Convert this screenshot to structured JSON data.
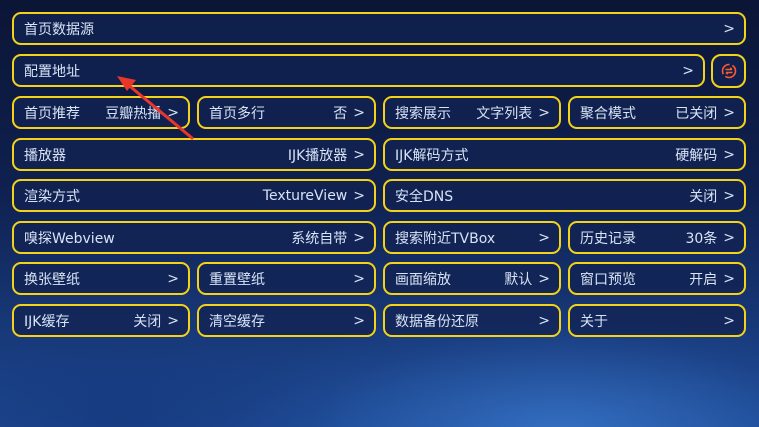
{
  "items": [
    {
      "label": "首页数据源",
      "value": "",
      "chevron": ">"
    },
    {
      "label": "配置地址",
      "value": "",
      "chevron": ">"
    },
    {
      "label": "首页推荐",
      "value": "豆瓣热播",
      "chevron": ">"
    },
    {
      "label": "首页多行",
      "value": "否",
      "chevron": ">"
    },
    {
      "label": "搜索展示",
      "value": "文字列表",
      "chevron": ">"
    },
    {
      "label": "聚合模式",
      "value": "已关闭",
      "chevron": ">"
    },
    {
      "label": "播放器",
      "value": "IJK播放器",
      "chevron": ">"
    },
    {
      "label": "IJK解码方式",
      "value": "硬解码",
      "chevron": ">"
    },
    {
      "label": "渲染方式",
      "value": "TextureView",
      "chevron": ">"
    },
    {
      "label": "安全DNS",
      "value": "关闭",
      "chevron": ">"
    },
    {
      "label": "嗅探Webview",
      "value": "系统自带",
      "chevron": ">"
    },
    {
      "label": "搜索附近TVBox",
      "value": "",
      "chevron": ">"
    },
    {
      "label": "历史记录",
      "value": "30条",
      "chevron": ">"
    },
    {
      "label": "换张壁纸",
      "value": "",
      "chevron": ">"
    },
    {
      "label": "重置壁纸",
      "value": "",
      "chevron": ">"
    },
    {
      "label": "画面缩放",
      "value": "默认",
      "chevron": ">"
    },
    {
      "label": "窗口预览",
      "value": "开启",
      "chevron": ">"
    },
    {
      "label": "IJK缓存",
      "value": "关闭",
      "chevron": ">"
    },
    {
      "label": "清空缓存",
      "value": "",
      "chevron": ">"
    },
    {
      "label": "数据备份还原",
      "value": "",
      "chevron": ">"
    },
    {
      "label": "关于",
      "value": "",
      "chevron": ">"
    }
  ],
  "icons": {
    "sync": "sync-icon",
    "annotation": "red-arrow-annotation"
  },
  "colors": {
    "border": "#f4d21a",
    "text": "#d8e3f5",
    "arrow": "#e8362a",
    "icon": "#ff5a2a"
  }
}
